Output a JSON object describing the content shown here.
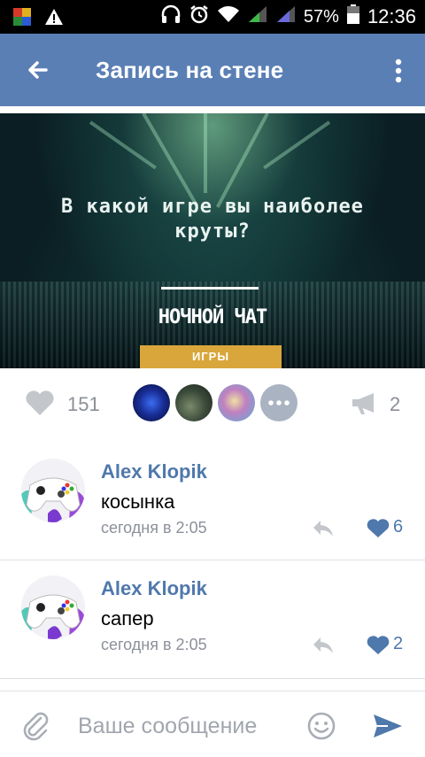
{
  "status_bar": {
    "battery_percent": "57%",
    "time": "12:36",
    "icons": [
      "gallery-icon",
      "warning-icon",
      "headphones-icon",
      "alarm-icon",
      "wifi-icon",
      "signal-icon",
      "signal-icon",
      "battery-icon"
    ]
  },
  "app_bar": {
    "title": "Запись на стене",
    "back_icon": "arrow-left-icon",
    "menu_icon": "more-vertical-icon",
    "color": "#5a7fb5"
  },
  "post": {
    "image_headline_line1": "В какой игре вы наиболее",
    "image_headline_line2": "круты?",
    "image_subtitle": "НОЧНОЙ ЧАТ",
    "image_tag": "ИГРЫ",
    "likes_count": "151",
    "shares_count": "2"
  },
  "comments": [
    {
      "author": "Alex Klopik",
      "text": "косынка",
      "time": "сегодня в 2:05",
      "likes": "6"
    },
    {
      "author": "Alex Klopik",
      "text": "сапер",
      "time": "сегодня в 2:05",
      "likes": "2"
    }
  ],
  "composer": {
    "placeholder": "Ваше сообщение"
  },
  "colors": {
    "accent": "#5a7fb5",
    "link": "#4f78ac",
    "tag": "#d8a63a"
  }
}
